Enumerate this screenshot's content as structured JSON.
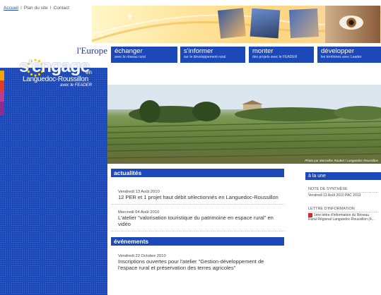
{
  "topnav": {
    "accueil": "Accueil",
    "sep1": "I",
    "plan": "Plan du site",
    "sep2": "I",
    "contact": "Contact"
  },
  "logo": {
    "europe": "l'Europe",
    "sengage": "s'engage",
    "en": "en",
    "region": "Languedoc-Roussillon",
    "frader": "avec le FEADER"
  },
  "nav": [
    {
      "title": "échanger",
      "sub": "avec le réseau rural"
    },
    {
      "title": "s'informer",
      "sub": "sur le développement rural"
    },
    {
      "title": "monter",
      "sub": "des projets avec le FEADER"
    },
    {
      "title": "développer",
      "sub": "les territoires avec Leader"
    }
  ],
  "hero": {
    "credit": "Photo par Marcellos Roubel / Languedoc-Roussillon"
  },
  "actualites": {
    "heading": "actualités",
    "items": [
      {
        "date": "Vendredi 13 Août 2010",
        "title": "12 PER et 1 projet haut débit sélectionnés en Languedoc-Roussillon"
      },
      {
        "date": "Mercredi 04 Août 2010",
        "title": "L'atelier \"valorisation touristique du patrimoine en espace rural\" en vidéo"
      }
    ]
  },
  "evenements": {
    "heading": "événements",
    "items": [
      {
        "date": "Vendredi 22 Octobre 2010",
        "title": "Inscriptions ouvertes pour l'atelier \"Gestion-développement de l'espace rural et préservation des terres agricoles\""
      }
    ]
  },
  "alaune": {
    "heading": "à la une",
    "note_label": "NOTE DE SYNTHÈSE",
    "note_text": "Vendredi 13 Août 2010 PAC 2013",
    "lettre_label": "LETTRE D'INFORMATION",
    "lettre_text": "1ère lettre d'information du Réseau Rural Régional Languedoc-Roussillon (4..."
  },
  "colors": {
    "brand_blue": "#1c49b7"
  }
}
